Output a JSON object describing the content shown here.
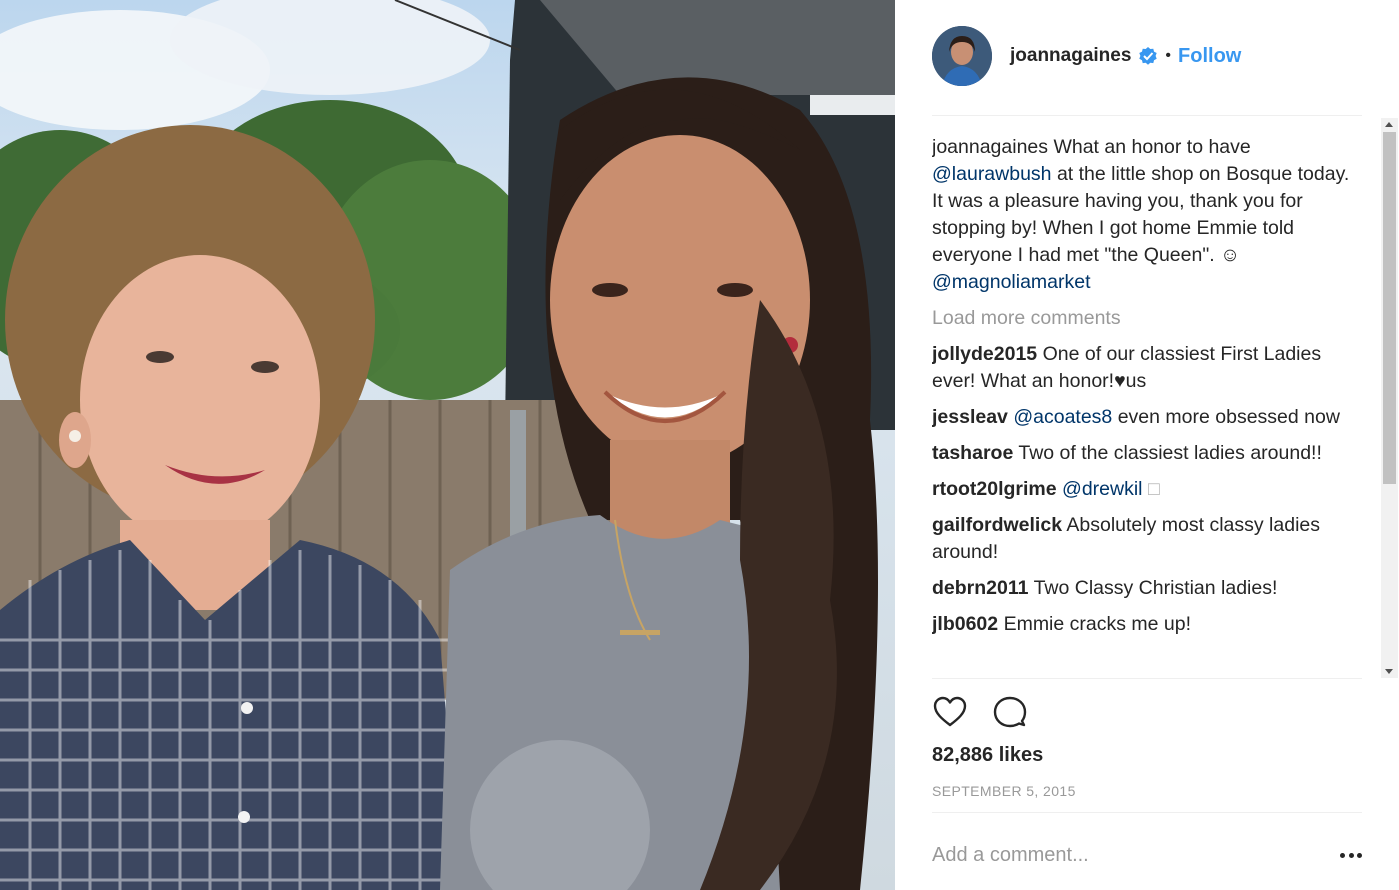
{
  "post": {
    "username": "joannagaines",
    "verified": true,
    "separator": "•",
    "follow_label": "Follow"
  },
  "caption": {
    "username": "joannagaines",
    "text_1": "What an honor to have",
    "mention_1": "@laurawbush",
    "text_2": "at the little shop on Bosque today. It was a pleasure having you, thank you for stopping by! When I got home Emmie told everyone I had met \"the Queen\". ☺",
    "mention_2": "@magnoliamarket"
  },
  "load_more_label": "Load more comments",
  "comments": [
    {
      "username": "jollyde2015",
      "text": "One of our classiest First Ladies ever! What an honor!♥us"
    },
    {
      "username": "jessleav",
      "mention": "@acoates8",
      "text": "even more obsessed now"
    },
    {
      "username": "tasharoe",
      "text": "Two of the classiest ladies around!!"
    },
    {
      "username": "rtoot20lgrime",
      "mention": "@drewkil",
      "text": "□"
    },
    {
      "username": "gailfordwelick",
      "text": "Absolutely most classy ladies around!"
    },
    {
      "username": "debrn2011",
      "text": "Two Classy Christian ladies!"
    },
    {
      "username": "jlb0602",
      "text": "Emmie cracks me up!"
    }
  ],
  "actions": {
    "like_icon": "heart-icon",
    "comment_icon": "comment-bubble-icon"
  },
  "likes": "82,886 likes",
  "date": "SEPTEMBER 5, 2015",
  "add_comment": {
    "placeholder": "Add a comment...",
    "more_icon": "more-options-icon"
  },
  "colors": {
    "link": "#3897f0",
    "mention": "#003569",
    "muted": "#999999",
    "text": "#262626"
  }
}
